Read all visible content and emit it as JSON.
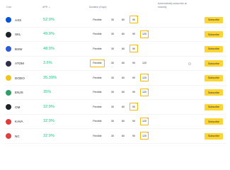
{
  "header": {
    "coin": "Coin",
    "apr": "APR",
    "duration": "Duration (Days)",
    "auto_subscribe": "Automatically subscribe at maturity"
  },
  "colors": {
    "accent": "#f0b90b",
    "button": "#fcd535",
    "positive": "#0ecb81"
  },
  "rows": [
    {
      "coin": "AXS",
      "apr": "52.9%",
      "icon_color": "#0055d5",
      "flexible": "Flexible",
      "durations": [
        "30",
        "60",
        "90"
      ],
      "selected": 2,
      "button": "Subscribe",
      "auto": false
    },
    {
      "coin": "SKL",
      "apr": "49.9%",
      "icon_color": "#1e2329",
      "flexible": "Flexible",
      "durations": [
        "30",
        "60",
        "90",
        "120"
      ],
      "selected": 3,
      "button": "Subscribe",
      "auto": false
    },
    {
      "coin": "BSW",
      "apr": "48.9%",
      "icon_color": "#2c5bd8",
      "flexible": "Flexible",
      "durations": [
        "30",
        "60",
        "90"
      ],
      "selected": 2,
      "button": "Subscribe",
      "auto": false
    },
    {
      "coin": "ATOM",
      "apr": "3.6%",
      "icon_color": "#2e3148",
      "flexible": "Flexible",
      "durations": [
        "30",
        "60",
        "90",
        "120"
      ],
      "selected": -1,
      "flexible_selected": true,
      "button": "Subscribe",
      "auto": true
    },
    {
      "coin": "DODO",
      "apr": "35.39%",
      "icon_color": "#f0c419",
      "flexible": "Flexible",
      "durations": [
        "30",
        "60",
        "90",
        "120"
      ],
      "selected": 3,
      "button": "Subscribe",
      "auto": false
    },
    {
      "coin": "ENJS",
      "apr": "35%",
      "icon_color": "#2f9e66",
      "flexible": "Flexible",
      "durations": [
        "30",
        "60",
        "90",
        "120"
      ],
      "selected": 3,
      "button": "Subscribe",
      "auto": false
    },
    {
      "coin": "OM",
      "apr": "32.9%",
      "icon_color": "#1e2329",
      "flexible": "Flexible",
      "durations": [
        "30",
        "60",
        "90"
      ],
      "selected": 2,
      "button": "Subscribe",
      "auto": false
    },
    {
      "coin": "KAVA",
      "apr": "32.9%",
      "icon_color": "#e03a3a",
      "flexible": "Flexible",
      "durations": [
        "30",
        "60",
        "90",
        "120"
      ],
      "selected": 3,
      "button": "Subscribe",
      "auto": false
    },
    {
      "coin": "NC",
      "apr": "32.9%",
      "icon_color": "#e04040",
      "flexible": "Flexible",
      "durations": [
        "30",
        "60",
        "90",
        "120"
      ],
      "selected": 3,
      "button": "Subscribe",
      "auto": false
    }
  ]
}
